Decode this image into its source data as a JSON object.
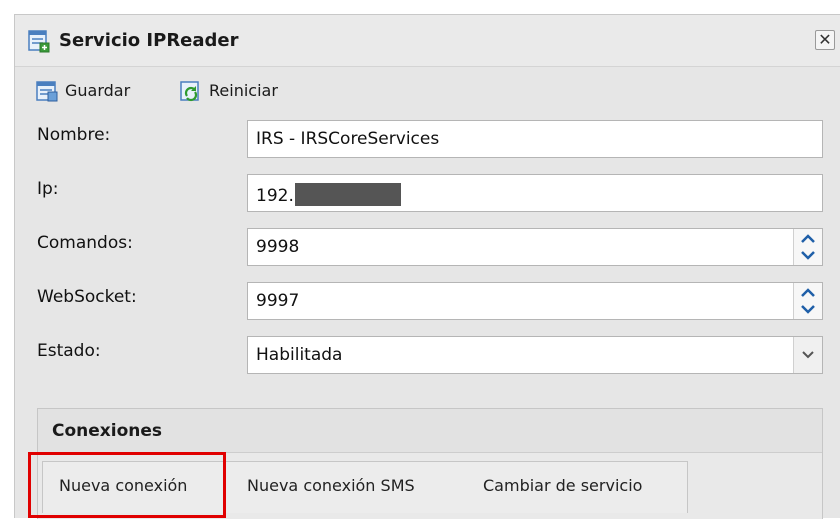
{
  "window": {
    "title": "Servicio IPReader",
    "title_icon": "document-form-icon",
    "close_glyph": "✕"
  },
  "toolbar": {
    "save_label": "Guardar",
    "save_icon": "save-icon",
    "restart_label": "Reiniciar",
    "restart_icon": "refresh-document-icon"
  },
  "form": {
    "nombre": {
      "label": "Nombre:",
      "value": "IRS - IRSCoreServices"
    },
    "ip": {
      "label": "Ip:",
      "value_prefix": "192."
    },
    "comandos": {
      "label": "Comandos:",
      "value": "9998"
    },
    "websocket": {
      "label": "WebSocket:",
      "value": "9997"
    },
    "estado": {
      "label": "Estado:",
      "value": "Habilitada"
    }
  },
  "connections": {
    "title": "Conexiones",
    "tabs": [
      {
        "label": "Nueva conexión"
      },
      {
        "label": "Nueva conexión SMS"
      },
      {
        "label": "Cambiar de servicio"
      }
    ]
  },
  "colors": {
    "highlight": "#e00000",
    "spinner_arrow": "#1f5fa8",
    "redaction": "#555555"
  }
}
